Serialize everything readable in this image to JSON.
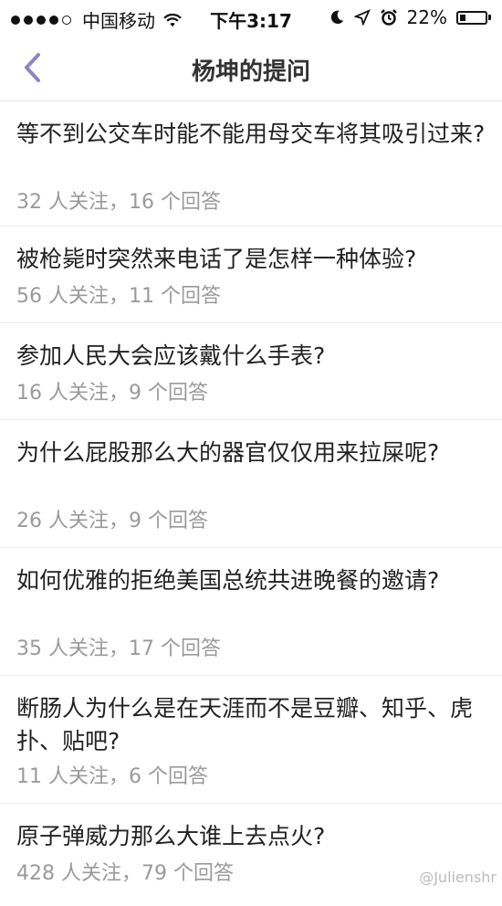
{
  "status_bar": {
    "carrier": "中国移动",
    "time": "下午3:17",
    "battery": "22%",
    "battery_level": 0.22,
    "signal_bars": 4
  },
  "nav": {
    "title": "杨坤的提问"
  },
  "questions": [
    {
      "title": "等不到公交车时能不能用母交车将其吸引过来?",
      "meta": "32 人关注，16 个回答"
    },
    {
      "title": "被枪毙时突然来电话了是怎样一种体验?",
      "meta": "56 人关注，11 个回答"
    },
    {
      "title": "参加人民大会应该戴什么手表?",
      "meta": "16 人关注，9 个回答"
    },
    {
      "title": "为什么屁股那么大的器官仅仅用来拉屎呢?",
      "meta": "26 人关注，9 个回答"
    },
    {
      "title": "如何优雅的拒绝美国总统共进晚餐的邀请?",
      "meta": "35 人关注，17 个回答"
    },
    {
      "title": "断肠人为什么是在天涯而不是豆瓣、知乎、虎扑、贴吧?",
      "meta": "11 人关注，6 个回答"
    },
    {
      "title": "原子弹威力那么大谁上去点火?",
      "meta": "428 人关注，79 个回答"
    }
  ],
  "watermark": "@Julienshr"
}
